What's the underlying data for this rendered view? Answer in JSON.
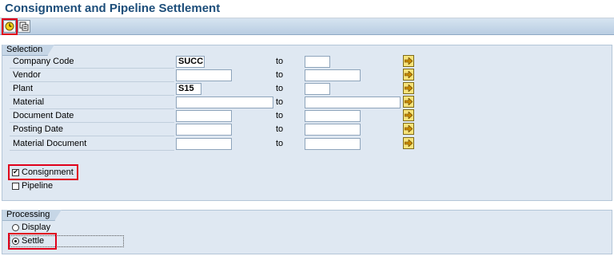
{
  "window": {
    "title": "Consignment and Pipeline Settlement"
  },
  "toolbar": {
    "execute_icon": "execute-clock-icon",
    "variant_icon": "get-variant-icon"
  },
  "selection": {
    "title": "Selection",
    "to_label": "to",
    "rows": [
      {
        "label": "Company Code",
        "from": "SUCC",
        "to": ""
      },
      {
        "label": "Vendor",
        "from": "",
        "to": ""
      },
      {
        "label": "Plant",
        "from": "S15",
        "to": ""
      },
      {
        "label": "Material",
        "from": "",
        "to": ""
      },
      {
        "label": "Document Date",
        "from": "",
        "to": ""
      },
      {
        "label": "Posting Date",
        "from": "",
        "to": ""
      },
      {
        "label": "Material Document",
        "from": "",
        "to": ""
      }
    ],
    "consignment": {
      "label": "Consignment",
      "checked": true
    },
    "pipeline": {
      "label": "Pipeline",
      "checked": false
    }
  },
  "processing": {
    "title": "Processing",
    "display": {
      "label": "Display",
      "selected": false
    },
    "settle": {
      "label": "Settle",
      "selected": true
    }
  },
  "colors": {
    "title": "#1d4e7a",
    "frame_bg": "#dfe8f2",
    "highlight": "#e0001b",
    "multi_select_button": "#f7e37a"
  }
}
